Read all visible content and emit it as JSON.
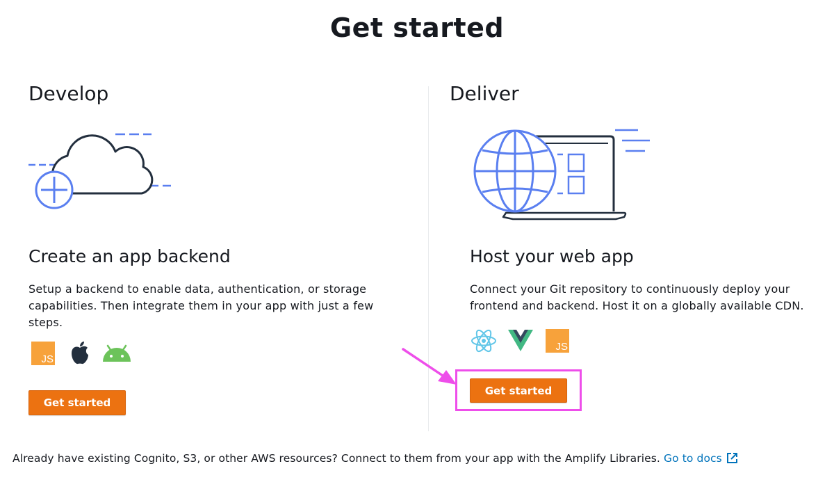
{
  "page": {
    "title": "Get started"
  },
  "develop": {
    "heading": "Develop",
    "card_title": "Create an app backend",
    "description": "Setup a backend to enable data, authentication, or storage capabilities. Then integrate them in your app with just a few steps.",
    "icons": [
      "javascript-icon",
      "apple-icon",
      "android-icon"
    ],
    "button_label": "Get started"
  },
  "deliver": {
    "heading": "Deliver",
    "card_title": "Host your web app",
    "description": "Connect your Git repository to continuously deploy your frontend and backend. Host it on a globally available CDN.",
    "icons": [
      "react-icon",
      "vue-icon",
      "javascript-icon"
    ],
    "button_label": "Get started"
  },
  "footer": {
    "text": "Already have existing Cognito, S3, or other AWS resources? Connect to them from your app with the Amplify Libraries.",
    "link_label": "Go to docs"
  },
  "colors": {
    "accent_orange": "#ec7211",
    "illustration_blue": "#5a7ff0",
    "link_blue": "#0073bb",
    "highlight_magenta": "#ee4eea"
  }
}
